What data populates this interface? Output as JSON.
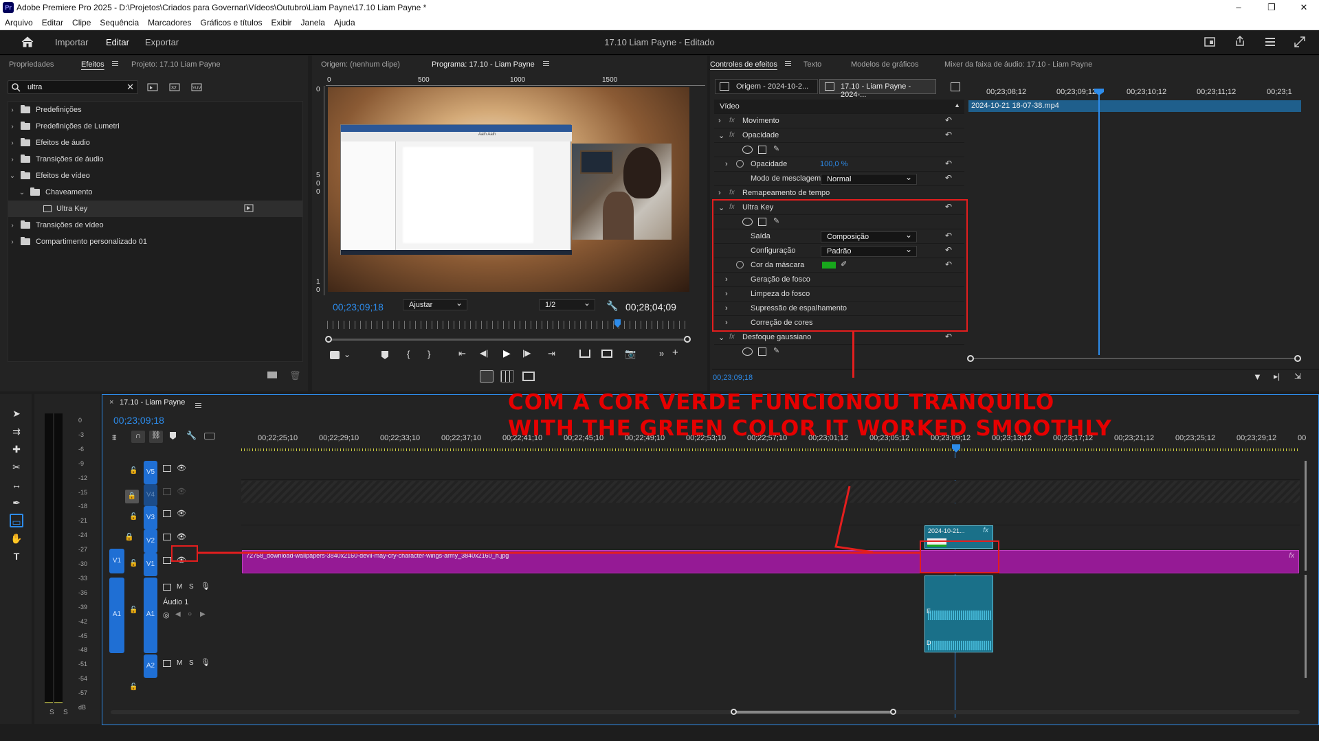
{
  "window": {
    "title": "Adobe Premiere Pro 2025 - D:\\Projetos\\Criados para Governar\\Vídeos\\Outubro\\Liam Payne\\17.10 Liam Payne *",
    "logo_text": "Pr",
    "controls": [
      "–",
      "❐",
      "✕"
    ]
  },
  "menu": [
    "Arquivo",
    "Editar",
    "Clipe",
    "Sequência",
    "Marcadores",
    "Gráficos e títulos",
    "Exibir",
    "Janela",
    "Ajuda"
  ],
  "workspace": {
    "tabs": [
      "Importar",
      "Editar",
      "Exportar"
    ],
    "active_tab": "Editar",
    "document_title": "17.10 Liam Payne - Editado"
  },
  "effects_panel": {
    "tabs": [
      "Propriedades",
      "Efeitos",
      "Projeto: 17.10 Liam Payne"
    ],
    "active_tab": "Efeitos",
    "search_value": "ultra",
    "tree": [
      {
        "label": "Predefinições",
        "expanded": false
      },
      {
        "label": "Predefinições de Lumetri",
        "expanded": false
      },
      {
        "label": "Efeitos de áudio",
        "expanded": false
      },
      {
        "label": "Transições de áudio",
        "expanded": false
      },
      {
        "label": "Efeitos de vídeo",
        "expanded": true
      },
      {
        "label": "Chaveamento",
        "expanded": true
      },
      {
        "label": "Ultra Key",
        "expanded": false
      },
      {
        "label": "Transições de vídeo",
        "expanded": false
      },
      {
        "label": "Compartimento personalizado 01",
        "expanded": false
      }
    ]
  },
  "program_monitor": {
    "tabs": [
      "Origem: (nenhum clipe)",
      "Programa: 17.10 - Liam Payne"
    ],
    "active_tab": "Programa: 17.10 - Liam Payne",
    "ruler_ticks": [
      "0",
      "500",
      "1000",
      "1500"
    ],
    "vruler_ticks": [
      "0",
      "5",
      "0",
      "0",
      "1",
      "0"
    ],
    "timecode": "00;23;09;18",
    "fit": "Ajustar",
    "resolution": "1/2",
    "duration": "00;28;04;09",
    "playhead_fraction": 0.8,
    "screen_text": "Aaih Aaih"
  },
  "effect_controls": {
    "tabs": [
      "Controles de efeitos",
      "Texto",
      "Modelos de gráficos",
      "Mixer da faixa de áudio: 17.10 - Liam Payne"
    ],
    "active_tab": "Controles de efeitos",
    "source_tab": "Origem - 2024-10-2...",
    "seq_tab": "17.10 - Liam Payne - 2024-...",
    "clip_name": "2024-10-21 18-07-38.mp4",
    "section": "Vídeo",
    "mini_ruler": [
      "00;23;08;12",
      "00;23;09;12",
      "00;23;10;12",
      "00;23;11;12",
      "00;23;1"
    ],
    "rows": {
      "movimento": "Movimento",
      "opacidade": "Opacidade",
      "opacidade_prop": "Opacidade",
      "opacidade_val": "100,0 %",
      "modo": "Modo de mesclagem",
      "modo_val": "Normal",
      "remap": "Remapeamento de tempo",
      "ultra": "Ultra Key",
      "saida": "Saída",
      "saida_val": "Composição",
      "config": "Configuração",
      "config_val": "Padrão",
      "cor": "Cor da máscara",
      "cor_hex": "#18a81c",
      "geracao": "Geração de fosco",
      "limpeza": "Limpeza do fosco",
      "supressao": "Supressão de espalhamento",
      "correcao": "Correção de cores",
      "desfoque": "Desfoque gaussiano"
    },
    "footer_timecode": "00;23;09;18"
  },
  "timeline": {
    "sequence_name": "17.10 - Liam Payne",
    "timecode": "00;23;09;18",
    "ruler": [
      "00;22;25;10",
      "00;22;29;10",
      "00;22;33;10",
      "00;22;37;10",
      "00;22;41;10",
      "00;22;45;10",
      "00;22;49;10",
      "00;22;53;10",
      "00;22;57;10",
      "00;23;01;12",
      "00;23;05;12",
      "00;23;09;12",
      "00;23;13;12",
      "00;23;17;12",
      "00;23;21;12",
      "00;23;25;12",
      "00;23;29;12",
      "00"
    ],
    "tracks": {
      "v5": "V5",
      "v4": "V4",
      "v3": "V3",
      "v2": "V2",
      "v1_src": "V1",
      "v1": "V1",
      "a1_src": "A1",
      "a1": "A1",
      "a1_name": "Áudio 1",
      "a2": "A2",
      "m": "M",
      "s": "S"
    },
    "clip_v1": "72758_download-wallpapers-3840x2160-devil-may-cry-character-wings-army_3840x2160_h.jpg",
    "clip_v2": "2024-10-21...",
    "fx_badge": "fx",
    "audio_labels": [
      "E",
      "D"
    ],
    "meter_scale": [
      "0",
      "-3",
      "-6",
      "-9",
      "-12",
      "-15",
      "-18",
      "-21",
      "-24",
      "-27",
      "-30",
      "-33",
      "-36",
      "-39",
      "-42",
      "-45",
      "-48",
      "-51",
      "-54",
      "-57",
      "dB"
    ],
    "meter_solo": [
      "S",
      "S"
    ]
  },
  "annotation": {
    "line1": "COM A COR VERDE FUNCIONOU TRANQUILO",
    "line2": "WITH THE GREEN COLOR IT WORKED SMOOTHLY",
    "color": "#e41e1e"
  }
}
